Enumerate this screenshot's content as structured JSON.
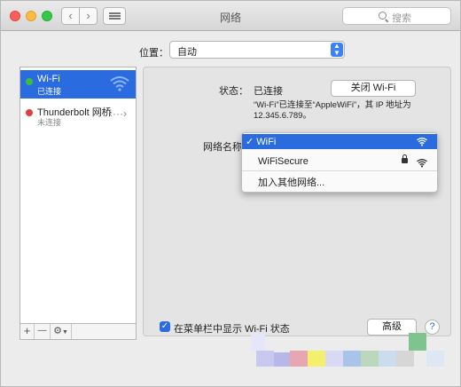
{
  "window": {
    "title": "网络"
  },
  "search": {
    "placeholder": "搜索"
  },
  "location": {
    "label": "位置：",
    "value": "自动"
  },
  "sidebar": {
    "items": [
      {
        "name": "Wi-Fi",
        "status": "已连接",
        "status_color": "#3bbf3b",
        "icon": "wifi-icon"
      },
      {
        "name": "Thunderbolt 网桥",
        "status": "未连接",
        "status_color": "#e83b3b",
        "icon": "thunderbolt-dots-icon"
      }
    ],
    "toolbar": {
      "add": "+",
      "remove": "—",
      "action": "⚙"
    }
  },
  "status": {
    "label": "状态：",
    "value": "已连接",
    "turn_off_button": "关闭 Wi-Fi",
    "description": "“Wi-Fi”已连接至“AppleWiFi”，其 IP 地址为 12.345.6.789。"
  },
  "network_name": {
    "label": "网络名称：",
    "options": [
      {
        "label": "WiFi",
        "selected": true,
        "secured": false
      },
      {
        "label": "WiFiSecure",
        "selected": false,
        "secured": true
      },
      {
        "label": "加入其他网络...",
        "selected": false,
        "secured": false
      }
    ]
  },
  "footer": {
    "show_wifi_status": "在菜单栏中显示 Wi-Fi 状态",
    "show_wifi_checked": true,
    "advanced_button": "高级",
    "help_button": "?"
  },
  "colors": {
    "accent": "#2a6ce0"
  }
}
